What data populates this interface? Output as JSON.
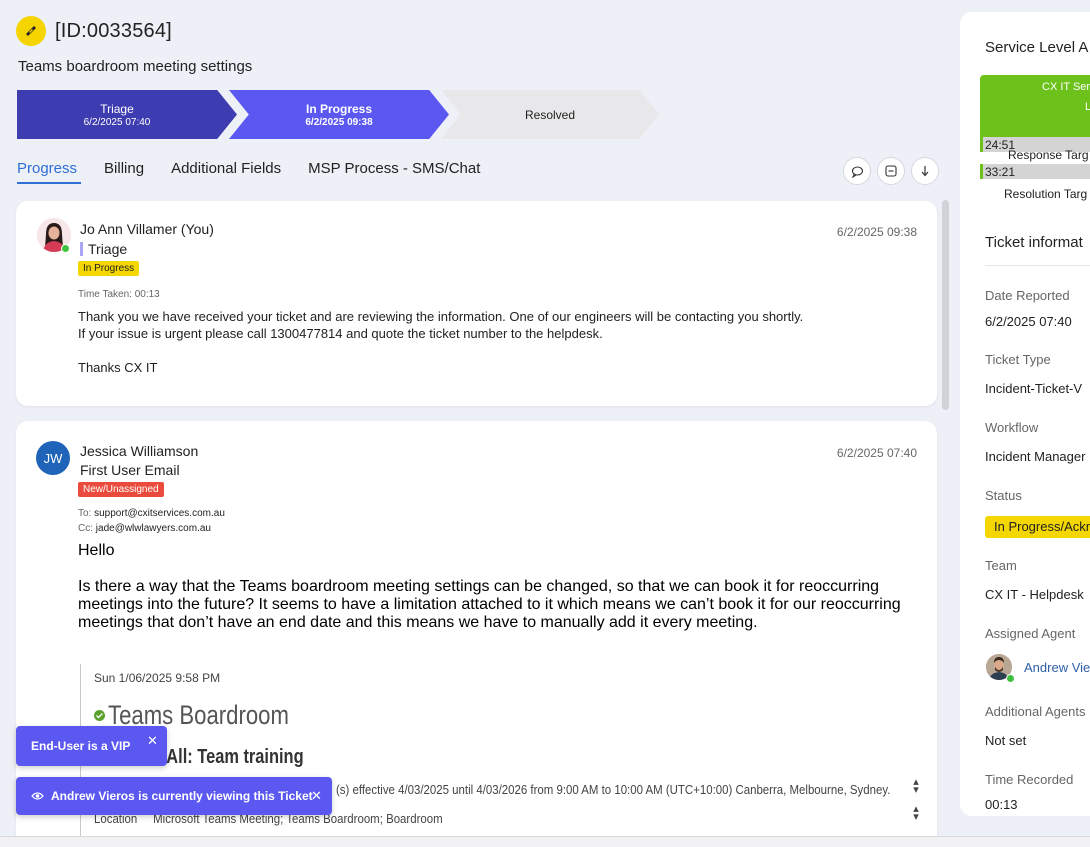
{
  "ticket": {
    "id": "[ID:0033564]",
    "subject": "Teams boardroom meeting settings"
  },
  "pipeline": [
    {
      "name": "Triage",
      "date": "6/2/2025 07:40"
    },
    {
      "name": "In Progress",
      "date": "6/2/2025 09:38"
    },
    {
      "name": "Resolved",
      "date": ""
    }
  ],
  "tabs": [
    "Progress",
    "Billing",
    "Additional Fields",
    "MSP Process - SMS/Chat"
  ],
  "entries": [
    {
      "author": "Jo Ann Villamer (You)",
      "stage": "Triage",
      "badge": "In Progress",
      "date": "6/2/2025 09:38",
      "time_taken": "Time Taken: 00:13",
      "lines": [
        "Thank you we have received your ticket and are reviewing the information. One of our engineers will be contacting you shortly.",
        "If your issue is urgent please call 1300477814 and quote the ticket number to the helpdesk.",
        "Thanks CX IT"
      ]
    },
    {
      "initials": "JW",
      "author": "Jessica Williamson",
      "subject": "First User Email",
      "badge": "New/Unassigned",
      "date": "6/2/2025 07:40",
      "to_label": "To:",
      "to": "support@cxitservices.com.au",
      "cc_label": "Cc:",
      "cc": "jade@wlwlawyers.com.au",
      "greeting": "Hello",
      "body": [
        "Is there a way that the Teams boardroom meeting settings can be changed, so that we can book it for reoccurring",
        "meetings into the future? It seems to have a limitation attached to it which means we can’t book it for our reoccurring",
        "meetings that don’t have an end date and this means we have to manually add it every meeting."
      ],
      "quoted": {
        "sent": "Sun 1/06/2025 9:58 PM",
        "title": "Teams Boardroom",
        "declined": "Declined All: Team training",
        "recurrence": "(s) effective 4/03/2025 until 4/03/2026 from 9:00 AM to 10:00 AM (UTC+10:00) Canberra, Melbourne, Sydney.",
        "location_label": "Location",
        "location": "Microsoft Teams Meeting; Teams Boardroom; Boardroom"
      }
    }
  ],
  "sla": {
    "title": "Service Level A",
    "header_l1": "CX IT Ser",
    "header_l2": "L",
    "response_time": "24:51",
    "response_label": "Response Targ",
    "resolution_time": "33:21",
    "resolution_label": "Resolution Targ"
  },
  "info": {
    "title": "Ticket informat",
    "date_reported_label": "Date Reported",
    "date_reported": "6/2/2025 07:40",
    "type_label": "Ticket Type",
    "type": "Incident-Ticket-V",
    "workflow_label": "Workflow",
    "workflow": "Incident Manager",
    "status_label": "Status",
    "status": "In Progress/Ackn",
    "team_label": "Team",
    "team": "CX IT - Helpdesk",
    "agent_label": "Assigned Agent",
    "agent": "Andrew Vie",
    "additional_label": "Additional Agents",
    "additional": "Not set",
    "time_label": "Time Recorded",
    "time": "00:13"
  },
  "toasts": {
    "vip": "End-User is a VIP",
    "viewing": "Andrew Vieros is currently viewing this Ticket"
  },
  "colors": {
    "primary": "#5b58f2",
    "primary_dark": "#3d3cb0",
    "badge_yellow": "#f4d600",
    "badge_red": "#ea4b3c",
    "sla_green": "#6cc21b"
  }
}
